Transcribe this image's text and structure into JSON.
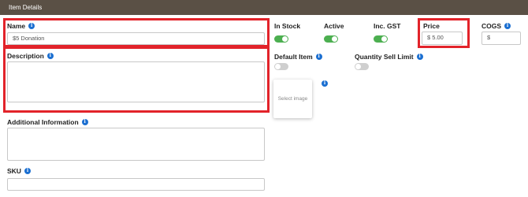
{
  "panel": {
    "title": "Item Details"
  },
  "fields": {
    "name": {
      "label": "Name",
      "value": "$5 Donation"
    },
    "description": {
      "label": "Description",
      "value": ""
    },
    "additional_information": {
      "label": "Additional Information",
      "value": ""
    },
    "sku": {
      "label": "SKU",
      "value": ""
    },
    "price": {
      "label": "Price",
      "value": "$ 5.00"
    },
    "cogs": {
      "label": "COGS",
      "value": "$"
    }
  },
  "toggles": {
    "in_stock": {
      "label": "In Stock",
      "on": true
    },
    "active": {
      "label": "Active",
      "on": true
    },
    "inc_gst": {
      "label": "Inc. GST",
      "on": true
    },
    "default_item": {
      "label": "Default Item",
      "on": false
    },
    "quantity_sell_limit": {
      "label": "Quantity Sell Limit",
      "on": false
    }
  },
  "image": {
    "placeholder": "Select image"
  },
  "icons": {
    "info": "info-icon"
  },
  "colors": {
    "header_bg": "#5a5045",
    "toggle_on": "#4caf50",
    "toggle_off": "#cfcfcf",
    "info_icon": "#1b6fd1",
    "highlight": "#e2232a"
  }
}
